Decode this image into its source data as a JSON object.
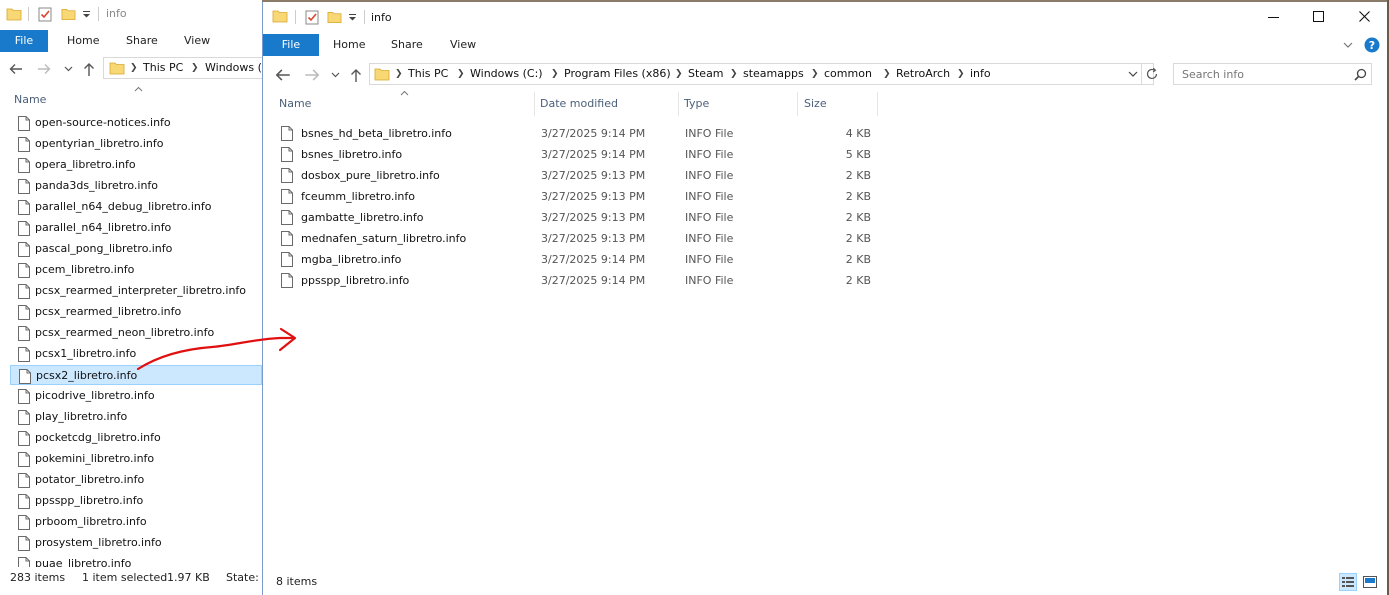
{
  "background_window": {
    "title": "info",
    "tabs": [
      "File",
      "Home",
      "Share",
      "View"
    ],
    "breadcrumbs": [
      "This PC",
      "Windows ("
    ],
    "column_name": "Name",
    "files": [
      "open-source-notices.info",
      "opentyrian_libretro.info",
      "opera_libretro.info",
      "panda3ds_libretro.info",
      "parallel_n64_debug_libretro.info",
      "parallel_n64_libretro.info",
      "pascal_pong_libretro.info",
      "pcem_libretro.info",
      "pcsx_rearmed_interpreter_libretro.info",
      "pcsx_rearmed_libretro.info",
      "pcsx_rearmed_neon_libretro.info",
      "pcsx1_libretro.info",
      "pcsx2_libretro.info",
      "picodrive_libretro.info",
      "play_libretro.info",
      "pocketcdg_libretro.info",
      "pokemini_libretro.info",
      "potator_libretro.info",
      "ppsspp_libretro.info",
      "prboom_libretro.info",
      "prosystem_libretro.info",
      "puae_libretro.info"
    ],
    "selected_index": 12,
    "status": {
      "count": "283 items",
      "selected": "1 item selected",
      "size": "1.97 KB",
      "state": "State:"
    }
  },
  "main_window": {
    "title": "info",
    "tabs": [
      "File",
      "Home",
      "Share",
      "View"
    ],
    "breadcrumbs": [
      "This PC",
      "Windows (C:)",
      "Program Files (x86)",
      "Steam",
      "steamapps",
      "common",
      "RetroArch",
      "info"
    ],
    "search_placeholder": "Search info",
    "columns": [
      "Name",
      "Date modified",
      "Type",
      "Size"
    ],
    "files": [
      {
        "name": "bsnes_hd_beta_libretro.info",
        "date": "3/27/2025 9:14 PM",
        "type": "INFO File",
        "size": "4 KB"
      },
      {
        "name": "bsnes_libretro.info",
        "date": "3/27/2025 9:14 PM",
        "type": "INFO File",
        "size": "5 KB"
      },
      {
        "name": "dosbox_pure_libretro.info",
        "date": "3/27/2025 9:13 PM",
        "type": "INFO File",
        "size": "2 KB"
      },
      {
        "name": "fceumm_libretro.info",
        "date": "3/27/2025 9:13 PM",
        "type": "INFO File",
        "size": "2 KB"
      },
      {
        "name": "gambatte_libretro.info",
        "date": "3/27/2025 9:13 PM",
        "type": "INFO File",
        "size": "2 KB"
      },
      {
        "name": "mednafen_saturn_libretro.info",
        "date": "3/27/2025 9:13 PM",
        "type": "INFO File",
        "size": "2 KB"
      },
      {
        "name": "mgba_libretro.info",
        "date": "3/27/2025 9:14 PM",
        "type": "INFO File",
        "size": "2 KB"
      },
      {
        "name": "ppsspp_libretro.info",
        "date": "3/27/2025 9:14 PM",
        "type": "INFO File",
        "size": "2 KB"
      }
    ],
    "status_count": "8 items"
  },
  "colors": {
    "accent": "#1979ca",
    "selection": "#cce8ff",
    "annotation": "#e01010",
    "folder": "#f8d775"
  },
  "icons": [
    "folder-icon",
    "properties-icon",
    "file-icon",
    "back-arrow-icon",
    "forward-arrow-icon",
    "up-arrow-icon",
    "search-icon",
    "refresh-icon",
    "help-icon",
    "minimize-icon",
    "maximize-icon",
    "close-icon"
  ]
}
